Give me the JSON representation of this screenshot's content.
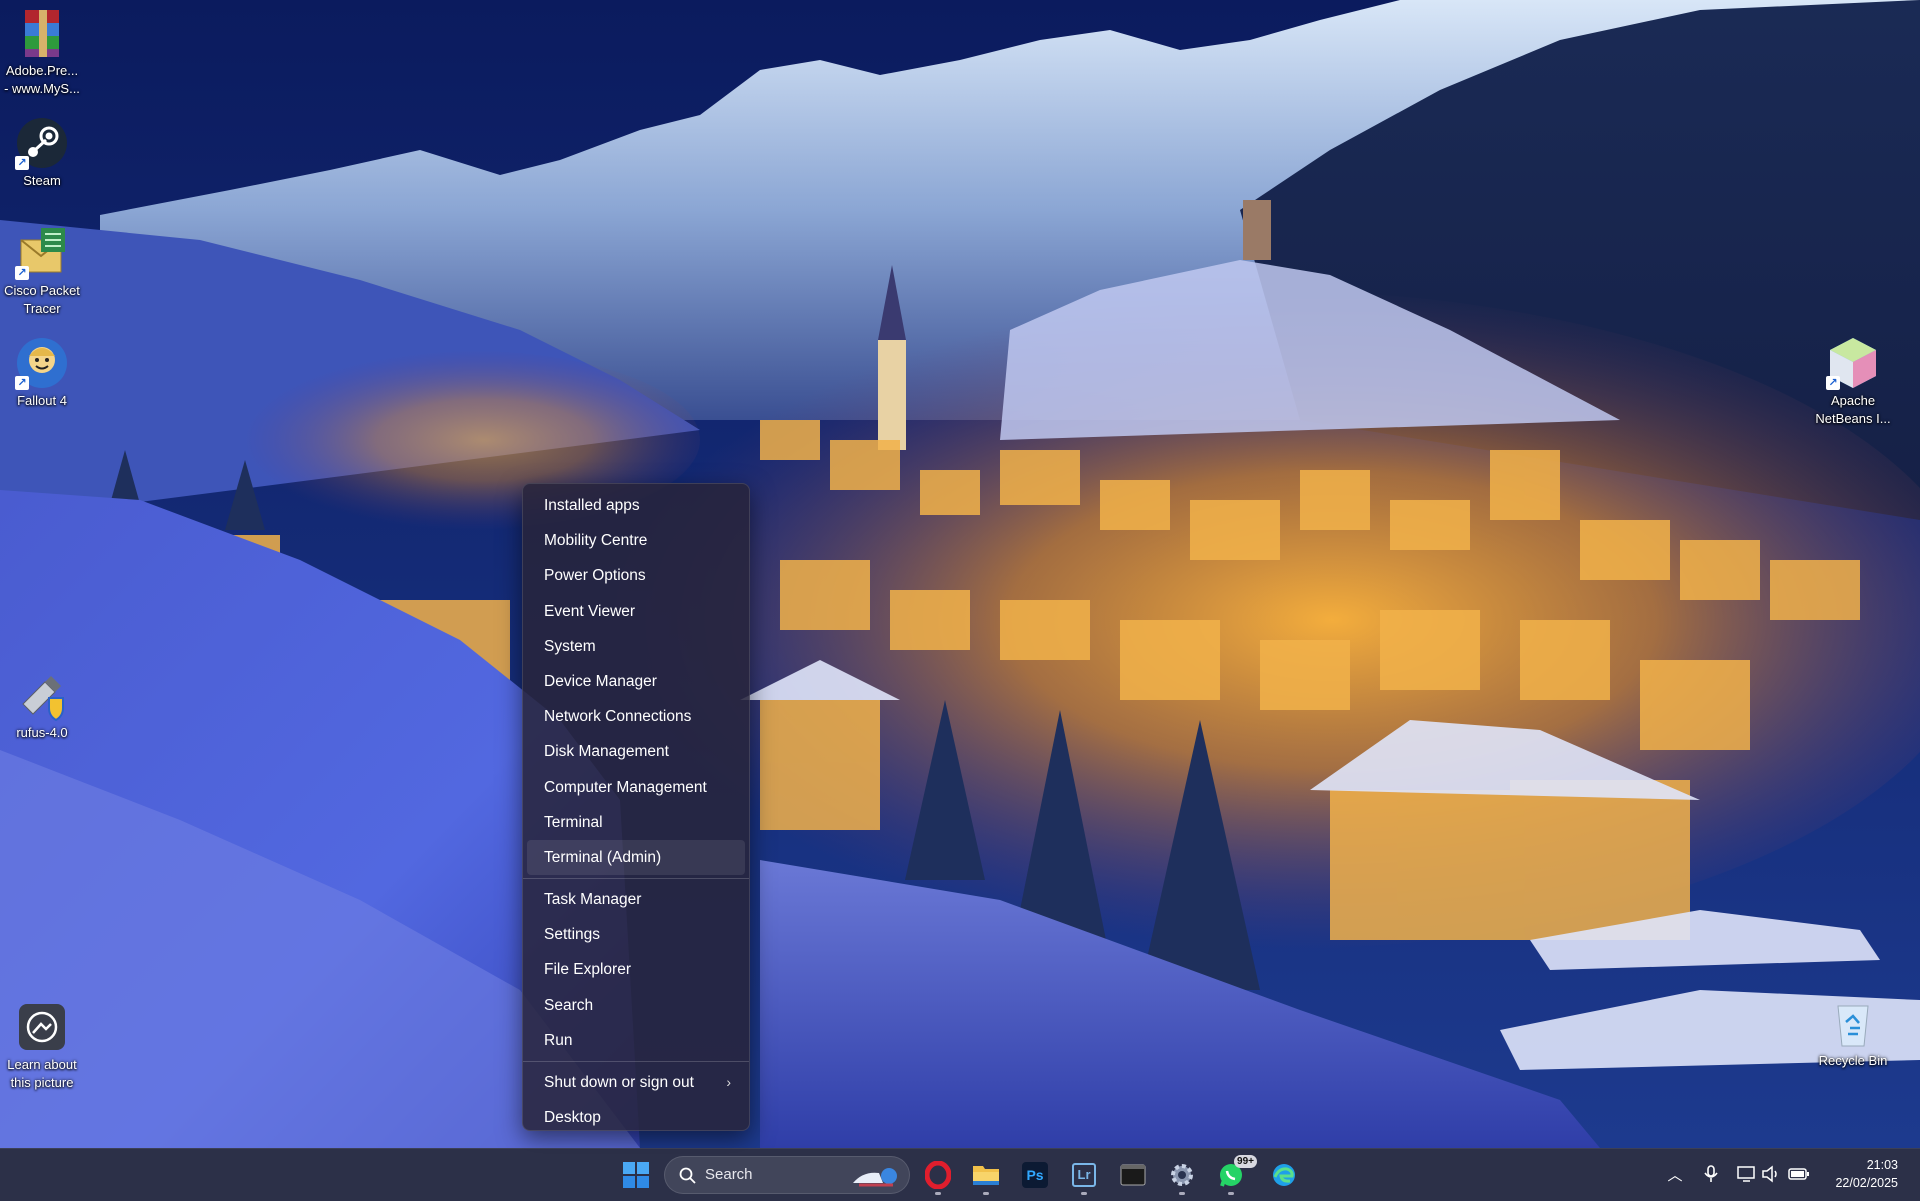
{
  "desktop": {
    "icons_left": [
      {
        "label_line1": "Adobe.Pre...",
        "label_line2": "- www.MyS...",
        "icon": "winrar-archive-icon"
      },
      {
        "label_line1": "Steam",
        "label_line2": "",
        "icon": "steam-icon"
      },
      {
        "label_line1": "Cisco Packet",
        "label_line2": "Tracer",
        "icon": "cisco-packet-tracer-icon"
      },
      {
        "label_line1": "Fallout 4",
        "label_line2": "",
        "icon": "fallout-4-icon"
      },
      {
        "label_line1": "rufus-4.0",
        "label_line2": "",
        "icon": "rufus-usb-icon"
      },
      {
        "label_line1": "Learn about",
        "label_line2": "this picture",
        "icon": "learn-about-picture-icon"
      }
    ],
    "icons_right": [
      {
        "label_line1": "Apache",
        "label_line2": "NetBeans I...",
        "icon": "netbeans-icon"
      },
      {
        "label_line1": "Recycle Bin",
        "label_line2": "",
        "icon": "recycle-bin-icon"
      }
    ]
  },
  "context_menu": {
    "group1": [
      "Installed apps",
      "Mobility Centre",
      "Power Options",
      "Event Viewer",
      "System",
      "Device Manager",
      "Network Connections",
      "Disk Management",
      "Computer Management",
      "Terminal",
      "Terminal (Admin)"
    ],
    "group2": [
      "Task Manager",
      "Settings",
      "File Explorer",
      "Search",
      "Run",
      "Shut down or sign out",
      "Desktop"
    ],
    "hovered_item": "Terminal (Admin)",
    "submenu_chevron": "›"
  },
  "taskbar": {
    "search_placeholder": "Search",
    "apps": [
      "start-icon",
      "opera-icon",
      "file-explorer-icon",
      "photoshop-icon",
      "lightroom-icon",
      "terminal-icon",
      "settings-gear-icon",
      "whatsapp-icon",
      "edge-icon"
    ],
    "photoshop_text": "Ps",
    "lightroom_text": "Lr",
    "whatsapp_badge": "99+",
    "tray": [
      "chevron-up-icon",
      "microphone-icon",
      "network-icon",
      "volume-icon",
      "battery-icon"
    ],
    "time": "21:03",
    "date": "22/02/2025"
  },
  "colors": {
    "menu_bg": "#28243a",
    "taskbar_bg": "#1c203a",
    "start_blue": "#3b9cf0",
    "opera_red": "#e01e2d"
  }
}
